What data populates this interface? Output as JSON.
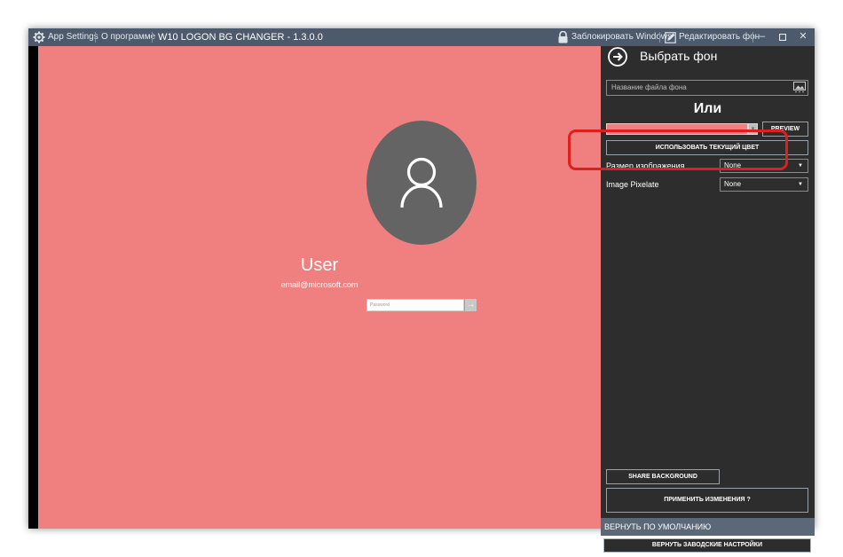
{
  "titlebar": {
    "settings_label": "App Settings",
    "about_label": "О программе",
    "app_title": "W10 LOGON BG CHANGER - 1.3.0.0",
    "lock_label": "Заблокировать Windows",
    "edit_bg_label": "Редактировать фон",
    "minimize": "–",
    "maximize": "▫",
    "close": "✕"
  },
  "preview": {
    "background_color": "#f07f7f",
    "user_name": "User",
    "user_email": "email@microsoft.com",
    "password_placeholder": "Password",
    "submit_glyph": "→"
  },
  "panel": {
    "header_title": "Выбрать фон",
    "file_placeholder": "Название файла фона",
    "or_label": "Или",
    "color_value": "#f07f7f",
    "preview_button": "PREVIEW",
    "use_current_color_button": "ИСПОЛЬЗОВАТЬ ТЕКУЩИЙ ЦВЕТ",
    "image_size_label": "Размер изображения",
    "image_size_value": "None",
    "pixelate_label": "Image Pixelate",
    "pixelate_value": "None",
    "share_button": "SHARE BACKGROUND",
    "apply_button": "ПРИМЕНИТЬ ИЗМЕНЕНИЯ ?",
    "restore_header": "ВЕРНУТЬ ПО УМОЛЧАНИЮ",
    "factory_reset_button": "ВЕРНУТЬ ЗАВОДСКИЕ НАСТРОЙКИ"
  },
  "icons": {
    "settings": "gear-icon",
    "lock": "lock-icon",
    "edit": "edit-icon",
    "next": "arrow-right-circle-icon",
    "user": "user-icon",
    "image": "image-icon",
    "dropdown": "caret-down-icon"
  },
  "colors": {
    "titlebar": "#4c5a6b",
    "panel": "#2d2d2d",
    "highlight": "#e01e1e",
    "avatar": "#646464"
  }
}
